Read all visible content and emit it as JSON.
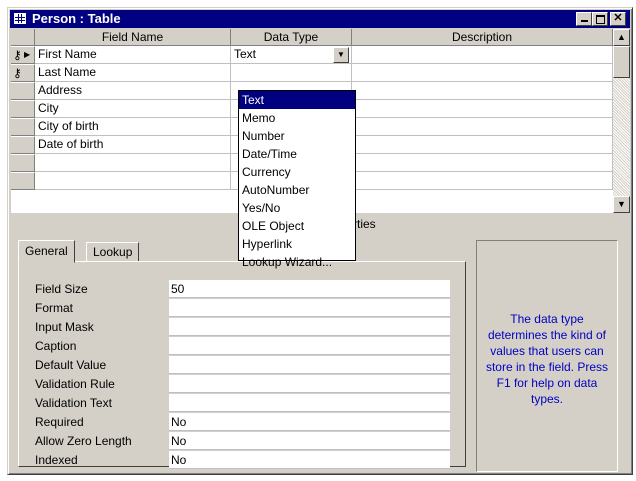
{
  "window": {
    "title": "Person : Table"
  },
  "grid": {
    "headers": {
      "field_name": "Field Name",
      "data_type": "Data Type",
      "description": "Description"
    },
    "rows": [
      {
        "field": "First Name",
        "type": "Text",
        "key": true,
        "current": true
      },
      {
        "field": "Last Name",
        "type": "",
        "key": true
      },
      {
        "field": "Address",
        "type": ""
      },
      {
        "field": "City",
        "type": ""
      },
      {
        "field": "City of birth",
        "type": ""
      },
      {
        "field": "Date of birth",
        "type": ""
      },
      {
        "field": "",
        "type": ""
      },
      {
        "field": "",
        "type": ""
      }
    ]
  },
  "dropdown": {
    "options": [
      "Text",
      "Memo",
      "Number",
      "Date/Time",
      "Currency",
      "AutoNumber",
      "Yes/No",
      "OLE Object",
      "Hyperlink",
      "Lookup Wizard..."
    ],
    "selected": "Text"
  },
  "field_properties": {
    "label_visible": "rties"
  },
  "tabs": {
    "general": "General",
    "lookup": "Lookup"
  },
  "properties": [
    {
      "label": "Field Size",
      "value": "50"
    },
    {
      "label": "Format",
      "value": ""
    },
    {
      "label": "Input Mask",
      "value": ""
    },
    {
      "label": "Caption",
      "value": ""
    },
    {
      "label": "Default Value",
      "value": ""
    },
    {
      "label": "Validation Rule",
      "value": ""
    },
    {
      "label": "Validation Text",
      "value": ""
    },
    {
      "label": "Required",
      "value": "No"
    },
    {
      "label": "Allow Zero Length",
      "value": "No"
    },
    {
      "label": "Indexed",
      "value": "No"
    }
  ],
  "help": {
    "text": "The data type determines the kind of values that users can store in the field.  Press F1 for help on data types."
  },
  "colors": {
    "titlebar": "#000080",
    "help_text": "#0000c0",
    "face": "#d4d0c8"
  }
}
